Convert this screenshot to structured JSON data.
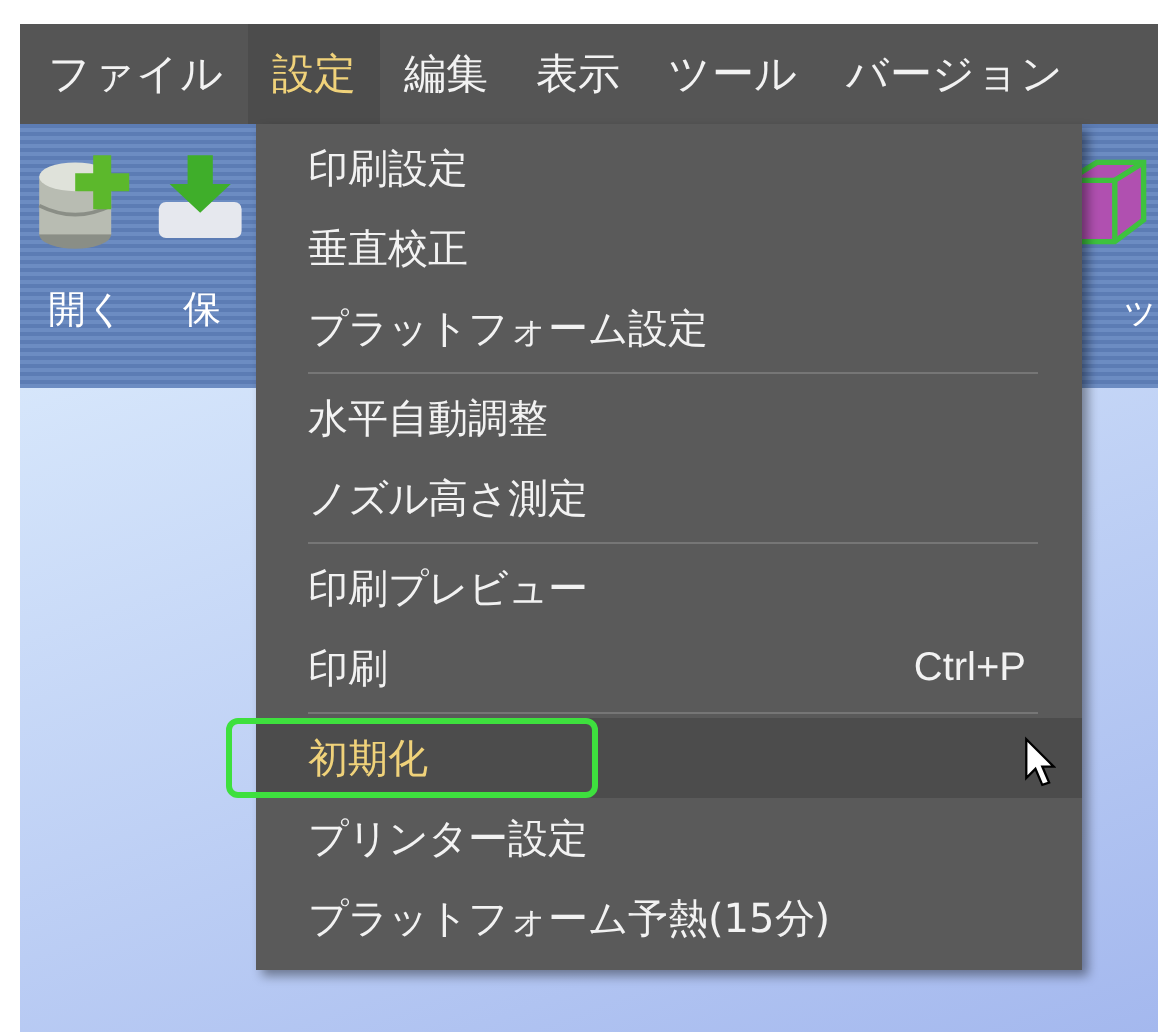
{
  "menubar": [
    {
      "label": "ファイル",
      "selected": false
    },
    {
      "label": "設定",
      "selected": true
    },
    {
      "label": "編集",
      "selected": false
    },
    {
      "label": "表示",
      "selected": false
    },
    {
      "label": "ツール",
      "selected": false
    },
    {
      "label": "バージョン",
      "selected": false
    }
  ],
  "toolbar": [
    {
      "label": "開く",
      "kind": "open"
    },
    {
      "label": "保",
      "kind": "save"
    },
    {
      "label": "ッ",
      "kind": "model"
    }
  ],
  "menu": [
    {
      "kind": "item",
      "label": "印刷設定",
      "selected": false,
      "annotated": false
    },
    {
      "kind": "item",
      "label": "垂直校正",
      "selected": false,
      "annotated": false
    },
    {
      "kind": "item",
      "label": "プラットフォーム設定",
      "selected": false,
      "annotated": false
    },
    {
      "kind": "separator"
    },
    {
      "kind": "item",
      "label": "水平自動調整",
      "selected": false,
      "annotated": false
    },
    {
      "kind": "item",
      "label": "ノズル高さ測定",
      "selected": false,
      "annotated": false
    },
    {
      "kind": "separator"
    },
    {
      "kind": "item",
      "label": "印刷プレビュー",
      "selected": false,
      "annotated": false
    },
    {
      "kind": "item",
      "label": "印刷",
      "shortcut": "Ctrl+P",
      "selected": false,
      "annotated": false
    },
    {
      "kind": "separator"
    },
    {
      "kind": "item",
      "label": "初期化",
      "selected": true,
      "annotated": true
    },
    {
      "kind": "item",
      "label": "プリンター設定",
      "selected": false,
      "annotated": false
    },
    {
      "kind": "item",
      "label": "プラットフォーム予熱(15分)",
      "selected": false,
      "annotated": false
    }
  ]
}
